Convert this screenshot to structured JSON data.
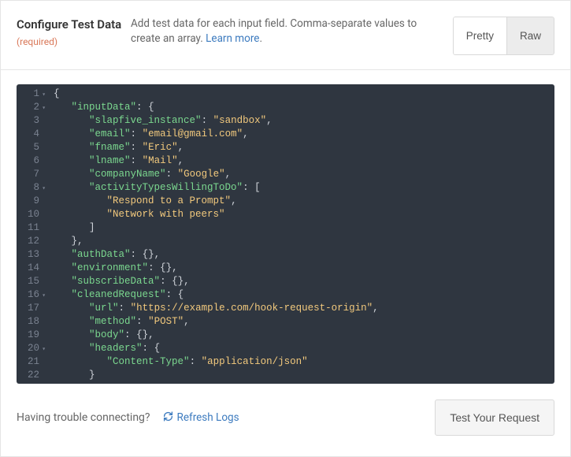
{
  "header": {
    "title": "Configure Test Data",
    "required_label": "(required)",
    "desc_prefix": "Add test data for each input field. Comma-separate values to create an array. ",
    "learn_more": "Learn more"
  },
  "toggle": {
    "pretty": "Pretty",
    "raw": "Raw"
  },
  "code": {
    "lines": [
      {
        "n": 1,
        "fold": true,
        "ind": 0,
        "tokens": [
          [
            "brace",
            "{"
          ]
        ]
      },
      {
        "n": 2,
        "fold": true,
        "ind": 1,
        "tokens": [
          [
            "key",
            "\"inputData\""
          ],
          [
            "punc",
            ": "
          ],
          [
            "brace",
            "{"
          ]
        ]
      },
      {
        "n": 3,
        "fold": false,
        "ind": 2,
        "tokens": [
          [
            "key",
            "\"slapfive_instance\""
          ],
          [
            "punc",
            ": "
          ],
          [
            "str",
            "\"sandbox\""
          ],
          [
            "punc",
            ","
          ]
        ]
      },
      {
        "n": 4,
        "fold": false,
        "ind": 2,
        "tokens": [
          [
            "key",
            "\"email\""
          ],
          [
            "punc",
            ": "
          ],
          [
            "str",
            "\"email@gmail.com\""
          ],
          [
            "punc",
            ","
          ]
        ]
      },
      {
        "n": 5,
        "fold": false,
        "ind": 2,
        "tokens": [
          [
            "key",
            "\"fname\""
          ],
          [
            "punc",
            ": "
          ],
          [
            "str",
            "\"Eric\""
          ],
          [
            "punc",
            ","
          ]
        ]
      },
      {
        "n": 6,
        "fold": false,
        "ind": 2,
        "tokens": [
          [
            "key",
            "\"lname\""
          ],
          [
            "punc",
            ": "
          ],
          [
            "str",
            "\"Mail\""
          ],
          [
            "punc",
            ","
          ]
        ]
      },
      {
        "n": 7,
        "fold": false,
        "ind": 2,
        "tokens": [
          [
            "key",
            "\"companyName\""
          ],
          [
            "punc",
            ": "
          ],
          [
            "str",
            "\"Google\""
          ],
          [
            "punc",
            ","
          ]
        ]
      },
      {
        "n": 8,
        "fold": true,
        "ind": 2,
        "tokens": [
          [
            "key",
            "\"activityTypesWillingToDo\""
          ],
          [
            "punc",
            ": ["
          ]
        ]
      },
      {
        "n": 9,
        "fold": false,
        "ind": 3,
        "tokens": [
          [
            "str",
            "\"Respond to a Prompt\""
          ],
          [
            "punc",
            ","
          ]
        ]
      },
      {
        "n": 10,
        "fold": false,
        "ind": 3,
        "tokens": [
          [
            "str",
            "\"Network with peers\""
          ]
        ]
      },
      {
        "n": 11,
        "fold": false,
        "ind": 2,
        "tokens": [
          [
            "punc",
            "]"
          ]
        ]
      },
      {
        "n": 12,
        "fold": false,
        "ind": 1,
        "tokens": [
          [
            "brace",
            "}"
          ],
          [
            "punc",
            ","
          ]
        ]
      },
      {
        "n": 13,
        "fold": false,
        "ind": 1,
        "tokens": [
          [
            "key",
            "\"authData\""
          ],
          [
            "punc",
            ": "
          ],
          [
            "brace",
            "{}"
          ],
          [
            "punc",
            ","
          ]
        ]
      },
      {
        "n": 14,
        "fold": false,
        "ind": 1,
        "tokens": [
          [
            "key",
            "\"environment\""
          ],
          [
            "punc",
            ": "
          ],
          [
            "brace",
            "{}"
          ],
          [
            "punc",
            ","
          ]
        ]
      },
      {
        "n": 15,
        "fold": false,
        "ind": 1,
        "tokens": [
          [
            "key",
            "\"subscribeData\""
          ],
          [
            "punc",
            ": "
          ],
          [
            "brace",
            "{}"
          ],
          [
            "punc",
            ","
          ]
        ]
      },
      {
        "n": 16,
        "fold": true,
        "ind": 1,
        "tokens": [
          [
            "key",
            "\"cleanedRequest\""
          ],
          [
            "punc",
            ": "
          ],
          [
            "brace",
            "{"
          ]
        ]
      },
      {
        "n": 17,
        "fold": false,
        "ind": 2,
        "tokens": [
          [
            "key",
            "\"url\""
          ],
          [
            "punc",
            ": "
          ],
          [
            "str",
            "\"https://example.com/hook-request-origin\""
          ],
          [
            "punc",
            ","
          ]
        ]
      },
      {
        "n": 18,
        "fold": false,
        "ind": 2,
        "tokens": [
          [
            "key",
            "\"method\""
          ],
          [
            "punc",
            ": "
          ],
          [
            "str",
            "\"POST\""
          ],
          [
            "punc",
            ","
          ]
        ]
      },
      {
        "n": 19,
        "fold": false,
        "ind": 2,
        "tokens": [
          [
            "key",
            "\"body\""
          ],
          [
            "punc",
            ": "
          ],
          [
            "brace",
            "{}"
          ],
          [
            "punc",
            ","
          ]
        ]
      },
      {
        "n": 20,
        "fold": true,
        "ind": 2,
        "tokens": [
          [
            "key",
            "\"headers\""
          ],
          [
            "punc",
            ": "
          ],
          [
            "brace",
            "{"
          ]
        ]
      },
      {
        "n": 21,
        "fold": false,
        "ind": 3,
        "tokens": [
          [
            "key",
            "\"Content-Type\""
          ],
          [
            "punc",
            ": "
          ],
          [
            "str",
            "\"application/json\""
          ]
        ]
      },
      {
        "n": 22,
        "fold": false,
        "ind": 2,
        "tokens": [
          [
            "brace",
            "}"
          ]
        ]
      }
    ]
  },
  "footer": {
    "trouble": "Having trouble connecting?",
    "refresh": "Refresh Logs",
    "test": "Test Your Request"
  }
}
